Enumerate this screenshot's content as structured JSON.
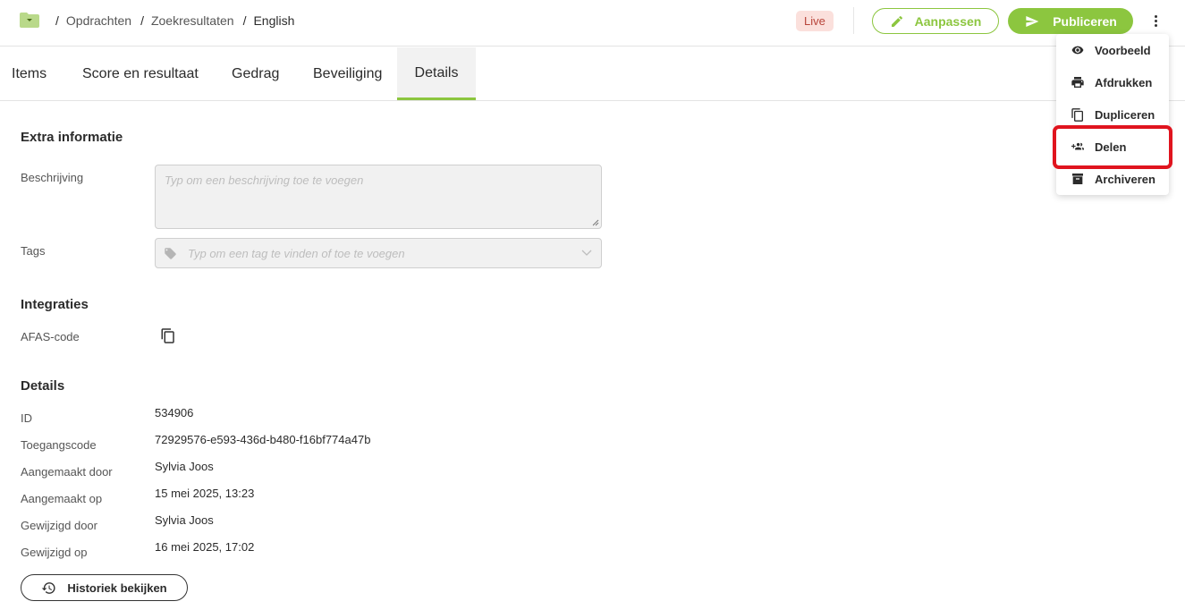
{
  "breadcrumb": {
    "items": [
      "Opdrachten",
      "Zoekresultaten"
    ],
    "current": "English",
    "separator": "/"
  },
  "header": {
    "status_badge": "Live",
    "edit_label": "Aanpassen",
    "publish_label": "Publiceren"
  },
  "tabs": [
    {
      "label": "Items"
    },
    {
      "label": "Score en resultaat"
    },
    {
      "label": "Gedrag"
    },
    {
      "label": "Beveiliging"
    },
    {
      "label": "Details"
    }
  ],
  "active_tab": "Details",
  "extra": {
    "title": "Extra informatie",
    "description_label": "Beschrijving",
    "description_placeholder": "Typ om een beschrijving toe te voegen",
    "tags_label": "Tags",
    "tags_placeholder": "Typ om een tag te vinden of toe te voegen"
  },
  "integrations": {
    "title": "Integraties",
    "afas_label": "AFAS-code"
  },
  "details": {
    "title": "Details",
    "rows": [
      {
        "label": "ID",
        "value": "534906"
      },
      {
        "label": "Toegangscode",
        "value": "72929576-e593-436d-b480-f16bf774a47b"
      },
      {
        "label": "Aangemaakt door",
        "value": "Sylvia Joos"
      },
      {
        "label": "Aangemaakt op",
        "value": "15 mei 2025, 13:23"
      },
      {
        "label": "Gewijzigd door",
        "value": "Sylvia Joos"
      },
      {
        "label": "Gewijzigd op",
        "value": "16 mei 2025, 17:02"
      }
    ],
    "history_button": "Historiek bekijken"
  },
  "menu": {
    "items": [
      {
        "label": "Voorbeeld",
        "icon": "eye-icon"
      },
      {
        "label": "Afdrukken",
        "icon": "printer-icon"
      },
      {
        "label": "Dupliceren",
        "icon": "copy-icon"
      },
      {
        "label": "Delen",
        "icon": "share-users-icon"
      },
      {
        "label": "Archiveren",
        "icon": "archive-icon"
      }
    ],
    "highlighted": "Delen"
  },
  "colors": {
    "accent": "#8cc63f",
    "live_bg": "#fbe0dc",
    "live_text": "#b8453a",
    "highlight": "#e0141e"
  }
}
